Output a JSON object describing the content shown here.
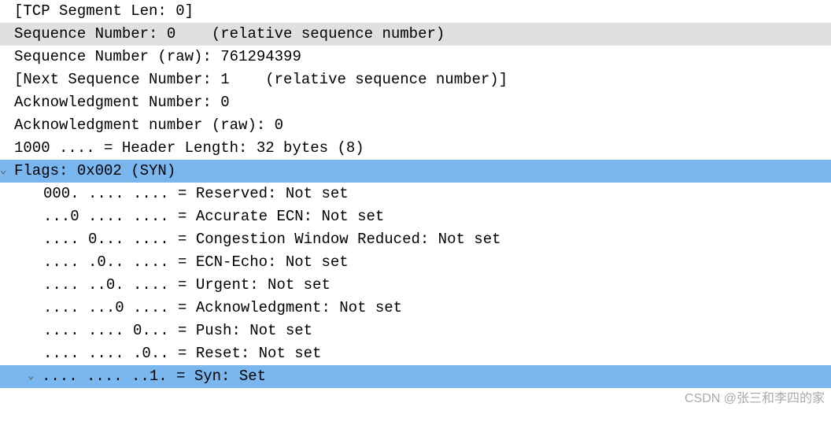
{
  "lines": {
    "seg_len": "[TCP Segment Len: 0]",
    "seq_rel": "Sequence Number: 0    (relative sequence number)",
    "seq_raw": "Sequence Number (raw): 761294399",
    "next_seq": "[Next Sequence Number: 1    (relative sequence number)]",
    "ack_num": "Acknowledgment Number: 0",
    "ack_raw": "Acknowledgment number (raw): 0",
    "hdr_len": "1000 .... = Header Length: 32 bytes (8)",
    "flags": "Flags: 0x002 (SYN)",
    "reserved": "000. .... .... = Reserved: Not set",
    "aecn": "...0 .... .... = Accurate ECN: Not set",
    "cwr": ".... 0... .... = Congestion Window Reduced: Not set",
    "ece": ".... .0.. .... = ECN-Echo: Not set",
    "urg": ".... ..0. .... = Urgent: Not set",
    "ack": ".... ...0 .... = Acknowledgment: Not set",
    "psh": ".... .... 0... = Push: Not set",
    "rst": ".... .... .0.. = Reset: Not set",
    "syn": ".... .... ..1. = Syn: Set"
  },
  "glyphs": {
    "down": "⌄",
    "down2": "⌄"
  },
  "watermark": "CSDN @张三和李四的家"
}
